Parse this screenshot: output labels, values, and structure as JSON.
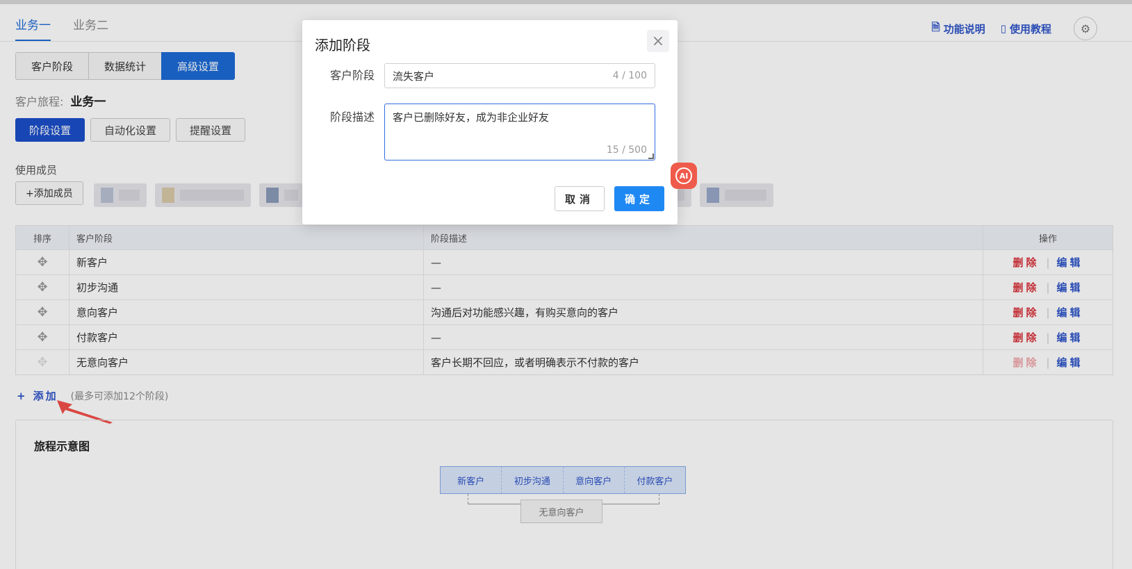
{
  "header": {
    "biz_tabs": [
      "业务一",
      "业务二"
    ],
    "links": {
      "feature_desc": "功能说明",
      "tutorial": "使用教程"
    }
  },
  "segments": [
    "客户阶段",
    "数据统计",
    "高级设置"
  ],
  "journey": {
    "label": "客户旅程:",
    "value": "业务一"
  },
  "subtabs": [
    "阶段设置",
    "自动化设置",
    "提醒设置"
  ],
  "members": {
    "label": "使用成员",
    "add_button": "+添加成员"
  },
  "table": {
    "headers": [
      "排序",
      "客户阶段",
      "阶段描述",
      "操作"
    ],
    "rows": [
      {
        "stage": "新客户",
        "desc": "—",
        "delete": "删除",
        "edit": "编辑"
      },
      {
        "stage": "初步沟通",
        "desc": "—",
        "delete": "删除",
        "edit": "编辑"
      },
      {
        "stage": "意向客户",
        "desc": "沟通后对功能感兴趣，有购买意向的客户",
        "delete": "删除",
        "edit": "编辑"
      },
      {
        "stage": "付款客户",
        "desc": "—",
        "delete": "删除",
        "edit": "编辑"
      },
      {
        "stage": "无意向客户",
        "desc": "客户长期不回应，或者明确表示不付款的客户",
        "delete": "删除",
        "edit": "编辑"
      }
    ]
  },
  "add_stage": {
    "label": "添加",
    "hint": "(最多可添加12个阶段)"
  },
  "diagram": {
    "title": "旅程示意图",
    "steps": [
      "新客户",
      "初步沟通",
      "意向客户",
      "付款客户"
    ],
    "exit": "无意向客户"
  },
  "dialog": {
    "title": "添加阶段",
    "stage_label": "客户阶段",
    "stage_value": "流失客户",
    "stage_counter": "4 / 100",
    "desc_label": "阶段描述",
    "desc_value": "客户已删除好友，成为非企业好友",
    "desc_counter": "15 / 500",
    "cancel": "取消",
    "ok": "确定",
    "ai_badge": "AI"
  },
  "colors": {
    "primary": "#1b6ad6",
    "danger": "#d9323a",
    "link": "#2f55c9",
    "ok_button": "#1e88f3"
  }
}
